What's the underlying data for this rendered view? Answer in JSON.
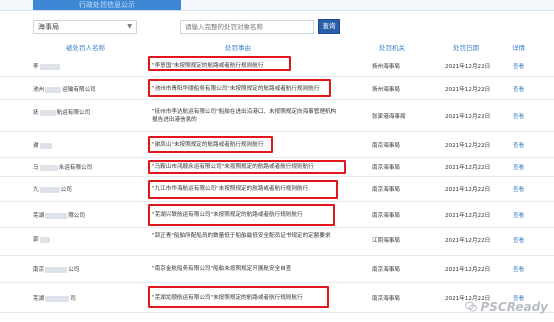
{
  "tab": {
    "label": "行政处罚信息公示"
  },
  "filter": {
    "agency": "海事局",
    "placeholder": "请输入完整的处罚对象名称",
    "query_label": "查询"
  },
  "columns": {
    "party": "被处罚人名称",
    "reason": "处罚事由",
    "org": "处罚机关",
    "date": "处罚日期",
    "detail": "详情"
  },
  "rows": [
    {
      "party": "李",
      "reason": "\"李意国\"未按照规定的航路或者航行规则航行",
      "org": "扬州海事局",
      "date": "2021年12月22日",
      "view": "查看"
    },
    {
      "party": "池州",
      "party_tail": "运输有限公司",
      "reason": "\"池州市青阳华顺船务有限公司\"未按照规定的航路或者航行规则航行",
      "org": "扬州海事局",
      "date": "2021年12月22日",
      "view": "查看"
    },
    {
      "party": "抚",
      "party_tail": "航运有限公司",
      "reason": "\"抚州市李达航运有限公司\"船舶在进出沿港口、未按照规定向海事管理机构报告进出港信息的",
      "org": "张家港海事局",
      "date": "2021年12月22日",
      "view": "查看"
    },
    {
      "party": "谢",
      "reason": "\"谢凤山\"未按照规定的航路或者航行规则航行",
      "org": "南京海事局",
      "date": "2021年12月22日",
      "view": "查看"
    },
    {
      "party": "马",
      "party_tail": "永运有限公司",
      "reason": "\"马鞍山市鸿顺永运有限公司\"未按照规定的航路或者航行规则航行",
      "org": "南京海事局",
      "date": "2021年12月22日",
      "view": "查看"
    },
    {
      "party": "九",
      "party_tail": "公司",
      "reason": "\"九江市华海航运有限公司\"未按照规定的航路或者航行规则航行",
      "org": "南京海事局",
      "date": "2021年12月22日",
      "view": "查看"
    },
    {
      "party": "芜湖",
      "party_tail": "限公司",
      "reason": "\"芜湖兴联航运有限公司\"未按照规定的航路或者航行规则航行",
      "org": "南京海事局",
      "date": "2021年12月22日",
      "view": "查看"
    },
    {
      "party": "郭",
      "reason": "\"郭正青\"船舶所配船员的数量低于船舶最低安全配员证书规定的定额要求",
      "org": "江阴海事局",
      "date": "2021年12月22日",
      "view": "查看"
    },
    {
      "party": "南京",
      "party_tail": "公司",
      "reason": "\"南京金航船务有限公司\"船舶未按照规定开展航安全自查",
      "org": "南京海事局",
      "date": "2021年12月22日",
      "view": "查看"
    },
    {
      "party": "芜湖",
      "party_tail": "司",
      "reason": "\"芜湖龙顺航运有限公司\"未按照规定的航路或者航行规则航行",
      "org": "南京海事局",
      "date": "2021年12月22日",
      "view": "查看"
    }
  ],
  "watermark": "PSCReady",
  "colors": {
    "highlight": "#e0171d",
    "accent": "#3f7fc9",
    "button": "#2a5fa8"
  }
}
